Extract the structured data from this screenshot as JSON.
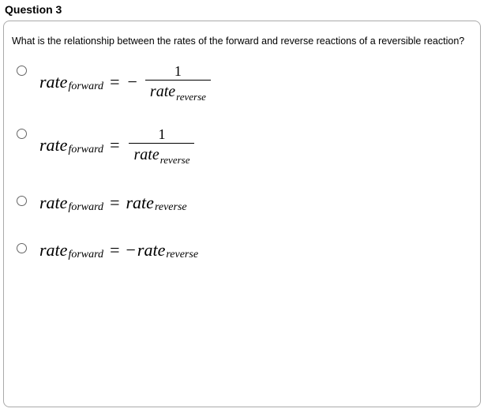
{
  "question": {
    "number_label": "Question 3",
    "prompt": "What is the relationship between the rates of the forward and reverse reactions of a reversible reaction?"
  },
  "math": {
    "rate": "rate",
    "forward": "forward",
    "reverse": "reverse",
    "equals": "=",
    "minus": "−",
    "one": "1"
  }
}
